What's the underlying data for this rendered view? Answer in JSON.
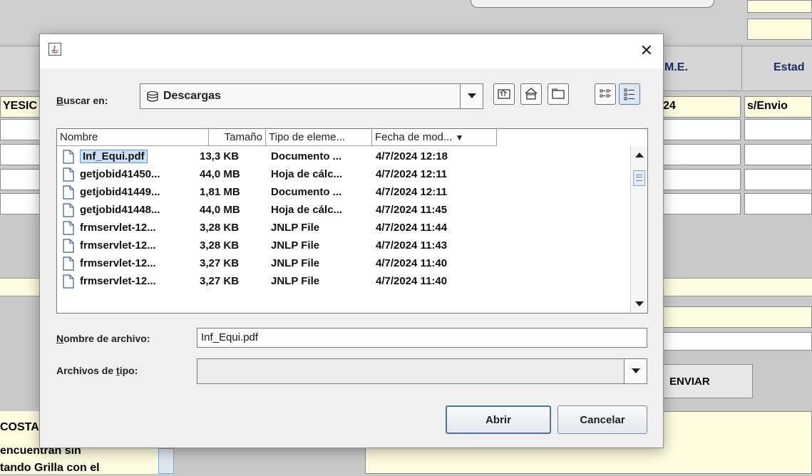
{
  "background": {
    "col_me": "M.E.",
    "col_estado": "Estad",
    "cell_left": "YESIC",
    "cell_me": "24",
    "cell_estado": "s/Envio",
    "enviar_label": "ENVIAR",
    "text_lines": [
      "COSTA",
      "encuentran sin",
      "tando Grilla con el"
    ]
  },
  "dialog": {
    "buscar_label_prefix": "B",
    "buscar_label_rest": "uscar en:",
    "location": "Descargas",
    "location_icon": "drive-icon",
    "toolbar": [
      "up-folder-icon",
      "home-icon",
      "new-folder-icon",
      "list-view-icon",
      "details-view-icon"
    ],
    "columns": [
      "Nombre",
      "Tamaño",
      "Tipo de eleme...",
      "Fecha de mod..."
    ],
    "sort_indicator": "▼",
    "files": [
      {
        "name": "Inf_Equi.pdf",
        "size": "13,3 KB",
        "type": "Documento ...",
        "date": "4/7/2024 12:18"
      },
      {
        "name": "getjobid41450...",
        "size": "44,0 MB",
        "type": "Hoja de cálc...",
        "date": "4/7/2024 12:11"
      },
      {
        "name": "getjobid41449...",
        "size": "1,81 MB",
        "type": "Documento ...",
        "date": "4/7/2024 12:11"
      },
      {
        "name": "getjobid41448...",
        "size": "44,0 MB",
        "type": "Hoja de cálc...",
        "date": "4/7/2024 11:45"
      },
      {
        "name": "frmservlet-12...",
        "size": "3,28 KB",
        "type": "JNLP File",
        "date": "4/7/2024 11:44"
      },
      {
        "name": "frmservlet-12...",
        "size": "3,28 KB",
        "type": "JNLP File",
        "date": "4/7/2024 11:43"
      },
      {
        "name": "frmservlet-12...",
        "size": "3,27 KB",
        "type": "JNLP File",
        "date": "4/7/2024 11:40"
      },
      {
        "name": "frmservlet-12...",
        "size": "3,27 KB",
        "type": "JNLP File",
        "date": "4/7/2024 11:40"
      }
    ],
    "selected_index": 0,
    "filename_label_prefix": "N",
    "filename_label_rest": "ombre de archivo:",
    "filename_value": "Inf_Equi.pdf",
    "filetype_label_pre": "Archivos de ",
    "filetype_label_u": "t",
    "filetype_label_post": "ipo:",
    "filetype_value": "",
    "open_label": "Abrir",
    "cancel_label": "Cancelar",
    "close_glyph": "✕"
  }
}
